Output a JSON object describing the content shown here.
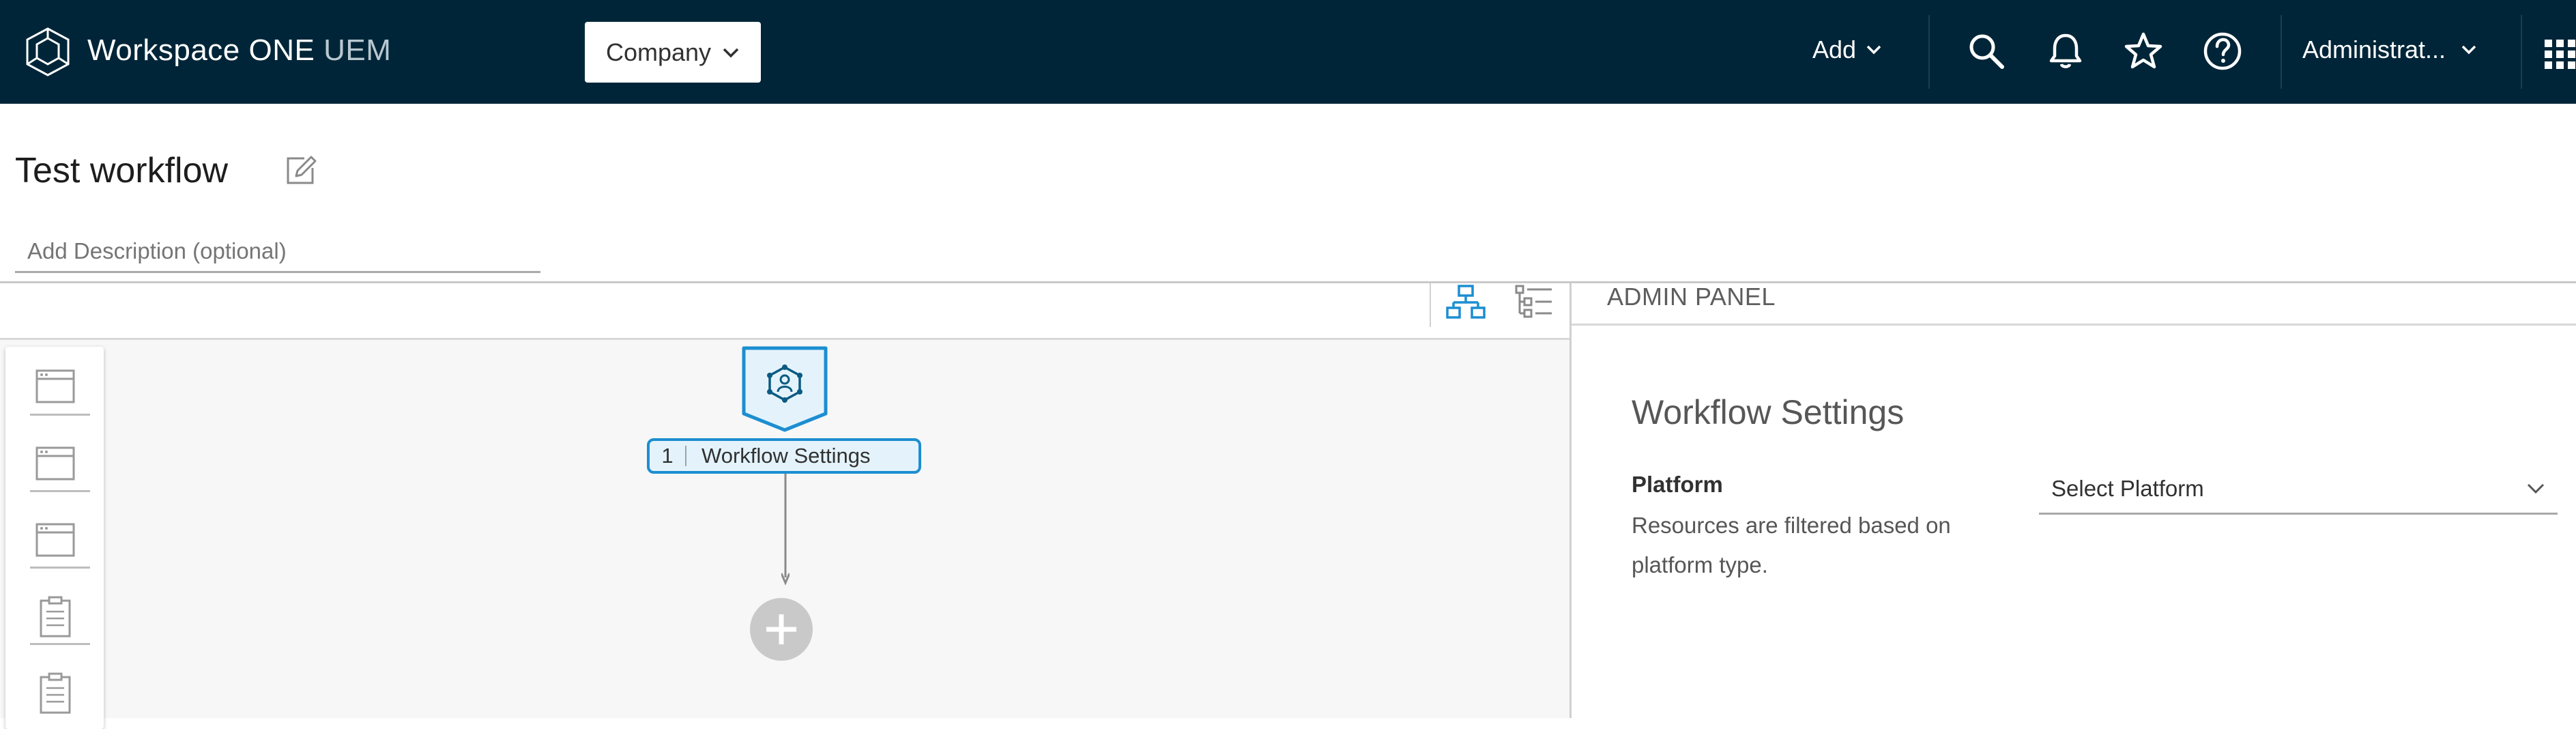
{
  "header": {
    "brand_main": "Workspace ONE",
    "brand_suffix": "UEM",
    "org_selector_label": "Company",
    "add_label": "Add",
    "user_label": "Administrat..."
  },
  "page": {
    "title": "Test workflow",
    "description_placeholder": "Add Description (optional)"
  },
  "canvas": {
    "node": {
      "number": "1",
      "label": "Workflow Settings"
    }
  },
  "admin_panel": {
    "heading": "ADMIN PANEL",
    "section_title": "Workflow Settings",
    "platform_label": "Platform",
    "platform_help": "Resources are filtered based on platform type.",
    "platform_select_value": "Select Platform"
  },
  "colors": {
    "topbar": "#002538",
    "accent": "#1c8ed1",
    "node_fill": "#e4f3fb"
  }
}
